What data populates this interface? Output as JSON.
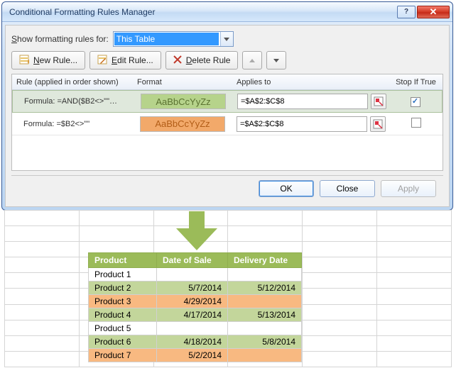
{
  "dialog": {
    "title": "Conditional Formatting Rules Manager",
    "show_label_pre": "S",
    "show_label_post": "how formatting rules for:",
    "combo_value": "This Table",
    "buttons": {
      "new": "New Rule...",
      "edit": "Edit Rule...",
      "delete": "Delete Rule"
    },
    "columns": {
      "rule": "Rule (applied in order shown)",
      "format": "Format",
      "applies": "Applies to",
      "stop": "Stop If True"
    },
    "rules": [
      {
        "formula": "Formula: =AND($B2<>\"\"…",
        "preview": "AaBbCcYyZz",
        "applies": "=$A$2:$C$8",
        "stop": true,
        "style": "green"
      },
      {
        "formula": "Formula: =$B2<>\"\"",
        "preview": "AaBbCcYyZz",
        "applies": "=$A$2:$C$8",
        "stop": false,
        "style": "orange"
      }
    ],
    "footer": {
      "ok": "OK",
      "close": "Close",
      "apply": "Apply"
    }
  },
  "sheet": {
    "headers": {
      "a": "Product",
      "b": "Date of Sale",
      "c": "Delivery Date"
    },
    "rows": [
      {
        "a": "Product 1",
        "b": "",
        "c": "",
        "fmt": "none"
      },
      {
        "a": "Product 2",
        "b": "5/7/2014",
        "c": "5/12/2014",
        "fmt": "green"
      },
      {
        "a": "Product 3",
        "b": "4/29/2014",
        "c": "",
        "fmt": "orange"
      },
      {
        "a": "Product 4",
        "b": "4/17/2014",
        "c": "5/13/2014",
        "fmt": "green"
      },
      {
        "a": "Product 5",
        "b": "",
        "c": "",
        "fmt": "none"
      },
      {
        "a": "Product 6",
        "b": "4/18/2014",
        "c": "5/8/2014",
        "fmt": "green"
      },
      {
        "a": "Product 7",
        "b": "5/2/2014",
        "c": "",
        "fmt": "orange"
      }
    ]
  }
}
